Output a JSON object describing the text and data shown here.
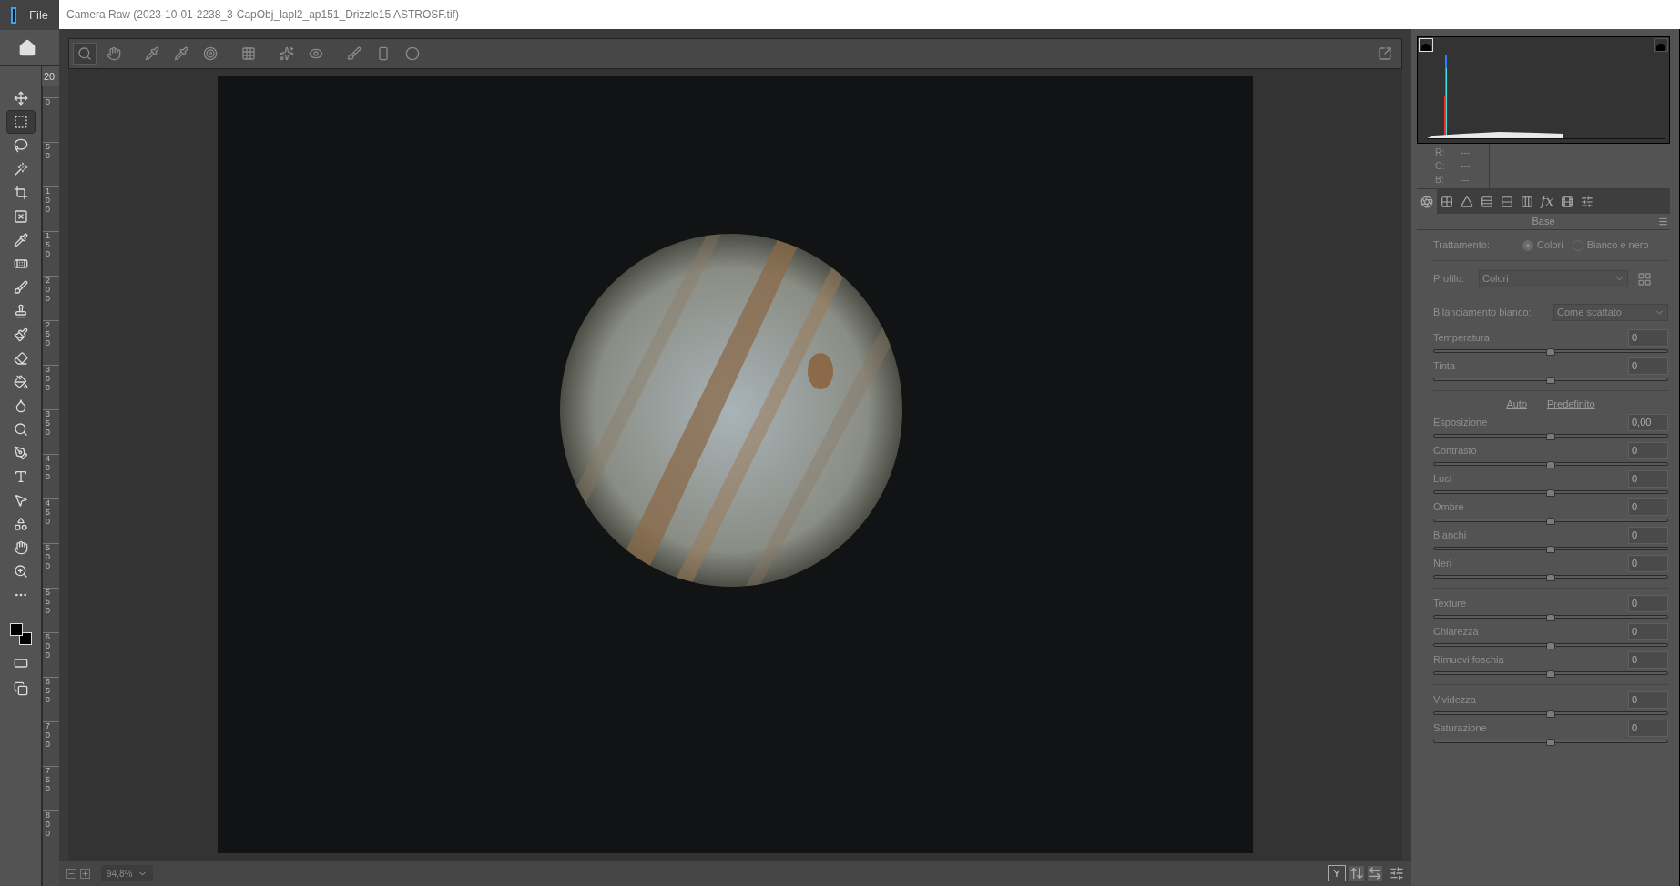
{
  "app": {
    "menu": [
      "File"
    ],
    "document_tab": "20",
    "ruler_marks": [
      "0",
      "50",
      "100",
      "150",
      "200",
      "250",
      "300",
      "350",
      "400",
      "450",
      "500",
      "550",
      "600",
      "650",
      "700",
      "750",
      "800"
    ],
    "tools": [
      {
        "selected": false
      },
      {
        "selected": true
      },
      {
        "selected": false
      },
      {
        "selected": false
      },
      {
        "selected": false
      },
      {
        "selected": false
      },
      {
        "selected": false
      },
      {
        "selected": false
      },
      {
        "selected": false
      },
      {
        "selected": false
      },
      {
        "selected": false
      },
      {
        "selected": false
      },
      {
        "selected": false
      },
      {
        "selected": false
      },
      {
        "selected": false
      },
      {
        "selected": false
      },
      {
        "selected": false
      },
      {
        "selected": false
      },
      {
        "selected": false
      },
      {
        "selected": false
      },
      {
        "selected": false
      },
      {
        "selected": false
      }
    ]
  },
  "window": {
    "title": "Camera Raw (2023-10-01-2238_3-CapObj_lapl2_ap151_Drizzle15 ASTROSF.tif)"
  },
  "toolbar": {
    "tools": [
      {
        "selected": true
      },
      {
        "selected": false
      },
      {
        "selected": false
      },
      {
        "selected": false
      },
      {
        "selected": false
      },
      {
        "selected": false
      },
      {
        "selected": false
      },
      {
        "selected": false
      },
      {
        "selected": false
      },
      {
        "selected": false
      },
      {
        "selected": false
      }
    ]
  },
  "histogram": {
    "clipping_warnings": [
      {
        "on": true
      },
      {
        "on": false
      }
    ],
    "readout": [
      {
        "channel": "R:",
        "value": "---"
      },
      {
        "channel": "G:",
        "value": "---"
      },
      {
        "channel": "B:",
        "value": "---"
      }
    ]
  },
  "panel": {
    "tabs": [
      {
        "selected": true
      },
      {
        "selected": false
      },
      {
        "selected": false
      },
      {
        "selected": false
      },
      {
        "selected": false
      },
      {
        "selected": false
      },
      {
        "selected": false,
        "label": "fx"
      },
      {
        "selected": false
      },
      {
        "selected": false
      }
    ],
    "section_title": "Base",
    "treatment": {
      "label": "Trattamento:",
      "options": [
        {
          "label": "Colori",
          "selected": true
        },
        {
          "label": "Bianco e nero",
          "selected": false
        }
      ]
    },
    "profile": {
      "label": "Profilo:",
      "value": "Colori"
    },
    "white_balance": {
      "label": "Bilanciamento bianco:",
      "value": "Come scattato"
    },
    "groups": [
      {
        "sliders": [
          {
            "label": "Temperatura",
            "value": "0",
            "level": 0.5
          },
          {
            "label": "Tinta",
            "value": "0",
            "level": 0.5
          }
        ]
      },
      {
        "links": [
          "Auto",
          "Predefinito"
        ],
        "sliders": [
          {
            "label": "Esposizione",
            "value": "0,00",
            "level": 0.5
          },
          {
            "label": "Contrasto",
            "value": "0",
            "level": 0.5
          },
          {
            "label": "Luci",
            "value": "0",
            "level": 0.5
          },
          {
            "label": "Ombre",
            "value": "0",
            "level": 0.5
          },
          {
            "label": "Bianchi",
            "value": "0",
            "level": 0.5
          },
          {
            "label": "Neri",
            "value": "0",
            "level": 0.5
          }
        ]
      },
      {
        "sliders": [
          {
            "label": "Texture",
            "value": "0",
            "level": 0.5
          },
          {
            "label": "Chiarezza",
            "value": "0",
            "level": 0.5
          },
          {
            "label": "Rimuovi foschia",
            "value": "0",
            "level": 0.5
          }
        ]
      },
      {
        "sliders": [
          {
            "label": "Vividezza",
            "value": "0",
            "level": 0.5
          },
          {
            "label": "Saturazione",
            "value": "0",
            "level": 0.5
          }
        ]
      }
    ]
  },
  "status_bar": {
    "zoom": "94,8%",
    "view_button": "Y"
  }
}
